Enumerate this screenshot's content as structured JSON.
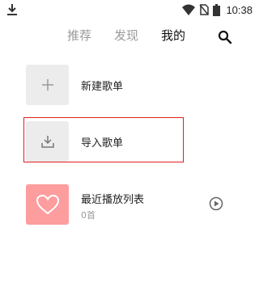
{
  "status_bar": {
    "time": "10:38",
    "icons": [
      "download-icon",
      "wifi-icon",
      "no-sim-icon",
      "battery-icon"
    ]
  },
  "nav": {
    "tabs": [
      {
        "label": "推荐",
        "active": false
      },
      {
        "label": "发现",
        "active": false
      },
      {
        "label": "我的",
        "active": true
      }
    ],
    "search_icon": "search-icon"
  },
  "playlists": {
    "new": {
      "title": "新建歌单",
      "icon": "plus-icon"
    },
    "import": {
      "title": "导入歌单",
      "icon": "import-icon"
    },
    "recent": {
      "title": "最近播放列表",
      "count": "0首",
      "icon": "heart-icon",
      "action_icon": "play-circle-icon"
    }
  },
  "colors": {
    "highlight": "#e02020",
    "recent_thumb": "#fd9d9e",
    "thumb_gray": "#ececec",
    "inactive_tab": "#9a9a9a"
  }
}
